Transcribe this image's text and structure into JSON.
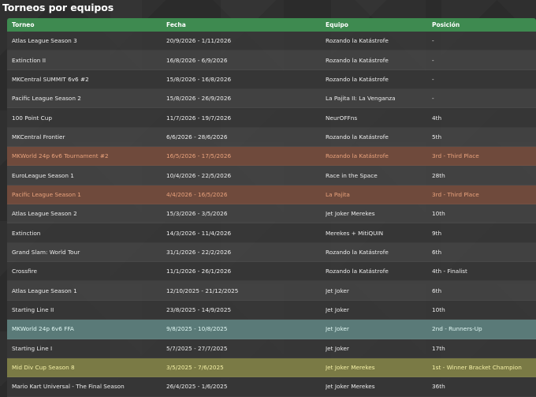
{
  "page": {
    "title": "Torneos por equipos"
  },
  "table": {
    "columns": [
      "Torneo",
      "Fecha",
      "Equipo",
      "Posición"
    ],
    "rows": [
      {
        "torneo": "Atlas League Season 3",
        "fecha": "20/9/2026 - 1/11/2026",
        "equipo": "Rozando la Katástrofe",
        "posicion": "-",
        "highlight": ""
      },
      {
        "torneo": "Extinction II",
        "fecha": "16/8/2026 - 6/9/2026",
        "equipo": "Rozando la Katástrofe",
        "posicion": "-",
        "highlight": ""
      },
      {
        "torneo": "MKCentral SUMMIT 6v6 #2",
        "fecha": "15/8/2026 - 16/8/2026",
        "equipo": "Rozando la Katástrofe",
        "posicion": "-",
        "highlight": ""
      },
      {
        "torneo": "Pacific League Season 2",
        "fecha": "15/8/2026 - 26/9/2026",
        "equipo": "La Pajita II: La Venganza",
        "posicion": "-",
        "highlight": ""
      },
      {
        "torneo": "100 Point Cup",
        "fecha": "11/7/2026 - 19/7/2026",
        "equipo": "NeurOFFns",
        "posicion": "4th",
        "highlight": ""
      },
      {
        "torneo": "MKCentral Frontier",
        "fecha": "6/6/2026 - 28/6/2026",
        "equipo": "Rozando la Katástrofe",
        "posicion": "5th",
        "highlight": ""
      },
      {
        "torneo": "MKWorld 24p 6v6 Tournament #2",
        "fecha": "16/5/2026 - 17/5/2026",
        "equipo": "Rozando la Katástrofe",
        "posicion": "3rd - Third Place",
        "highlight": "bronze"
      },
      {
        "torneo": "EuroLeague Season 1",
        "fecha": "10/4/2026 - 22/5/2026",
        "equipo": "Race in the Space",
        "posicion": "28th",
        "highlight": ""
      },
      {
        "torneo": "Pacific League Season 1",
        "fecha": "4/4/2026 - 16/5/2026",
        "equipo": "La Pajita",
        "posicion": "3rd - Third Place",
        "highlight": "bronze"
      },
      {
        "torneo": "Atlas League Season 2",
        "fecha": "15/3/2026 - 3/5/2026",
        "equipo": "Jet Joker Merekes",
        "posicion": "10th",
        "highlight": ""
      },
      {
        "torneo": "Extinction",
        "fecha": "14/3/2026 - 11/4/2026",
        "equipo": "Merekes + MitiQUIN",
        "posicion": "9th",
        "highlight": ""
      },
      {
        "torneo": "Grand Slam: World Tour",
        "fecha": "31/1/2026 - 22/2/2026",
        "equipo": "Rozando la Katástrofe",
        "posicion": "6th",
        "highlight": ""
      },
      {
        "torneo": "Crossfire",
        "fecha": "11/1/2026 - 26/1/2026",
        "equipo": "Rozando la Katástrofe",
        "posicion": "4th - Finalist",
        "highlight": ""
      },
      {
        "torneo": "Atlas League Season 1",
        "fecha": "12/10/2025 - 21/12/2025",
        "equipo": "Jet Joker",
        "posicion": "6th",
        "highlight": ""
      },
      {
        "torneo": "Starting Line II",
        "fecha": "23/8/2025 - 14/9/2025",
        "equipo": "Jet Joker",
        "posicion": "10th",
        "highlight": ""
      },
      {
        "torneo": "MKWorld 24p 6v6 FFA",
        "fecha": "9/8/2025 - 10/8/2025",
        "equipo": "Jet Joker",
        "posicion": "2nd - Runners-Up",
        "highlight": "silver"
      },
      {
        "torneo": "Starting Line I",
        "fecha": "5/7/2025 - 27/7/2025",
        "equipo": "Jet Joker",
        "posicion": "17th",
        "highlight": ""
      },
      {
        "torneo": "Mid Div Cup Season 8",
        "fecha": "3/5/2025 - 7/6/2025",
        "equipo": "Jet Joker Merekes",
        "posicion": "1st - Winner Bracket Champion",
        "highlight": "gold"
      },
      {
        "torneo": "Mario Kart Universal - The Final Season",
        "fecha": "26/4/2025 - 1/6/2025",
        "equipo": "Jet Joker Merekes",
        "posicion": "36th",
        "highlight": ""
      }
    ]
  },
  "colors": {
    "header": "#3e8a50",
    "bronze": "#6f4a3c",
    "silver": "#5a7a78",
    "gold": "#7a7a45"
  }
}
